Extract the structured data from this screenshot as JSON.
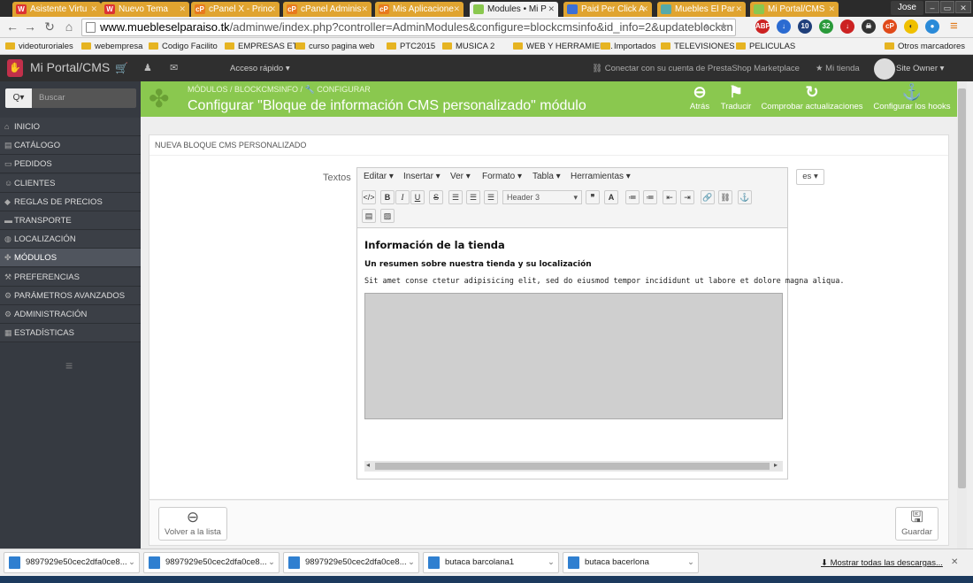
{
  "browser": {
    "tabs": [
      {
        "label": "Asistente Virtu",
        "fav": "W",
        "color": "#d33"
      },
      {
        "label": "Nuevo Tema",
        "fav": "W",
        "color": "#d33"
      },
      {
        "label": "cPanel X - Princ",
        "fav": "cP",
        "color": "#e87a1e"
      },
      {
        "label": "cPanel Adminis",
        "fav": "cP",
        "color": "#e87a1e"
      },
      {
        "label": "Mis Aplicacione",
        "fav": "cP",
        "color": "#e87a1e"
      },
      {
        "label": "Modules • Mi P",
        "fav": "",
        "color": "#8ac84f"
      },
      {
        "label": "Paid Per Click A",
        "fav": "",
        "color": "#3b6fd6"
      },
      {
        "label": "Muebles El Par",
        "fav": "",
        "color": "#5aa"
      },
      {
        "label": "Mi Portal/CMS",
        "fav": "",
        "color": "#8ac84f"
      }
    ],
    "user": "Jose",
    "url_domain": "www.muebleselparaiso.tk",
    "url_path": "/adminwe/index.php?controller=AdminModules&configure=blockcmsinfo&id_info=2&updateblockcn",
    "bookmarks": [
      "videoturoriales",
      "webempresa",
      "Codigo Facilito",
      "EMPRESAS ETT",
      "curso pagina web",
      "PTC2015",
      "MUSICA 2",
      "WEB Y HERRAMIEN...",
      "Importados",
      "TELEVISIONES",
      "PELICULAS"
    ],
    "other_bookmarks": "Otros marcadores"
  },
  "admin": {
    "site_title": "Mi Portal/CMS",
    "quick_access": "Acceso rápido",
    "marketplace": "Conectar con su cuenta de PrestaShop Marketplace",
    "my_store": "Mi tienda",
    "owner": "Site Owner",
    "search_placeholder": "Buscar",
    "search_prefix": "Q▾"
  },
  "sidebar": {
    "items": [
      {
        "label": "INICIO",
        "icon": "home-icon"
      },
      {
        "label": "CATÁLOGO",
        "icon": "book-icon"
      },
      {
        "label": "PEDIDOS",
        "icon": "credit-card-icon"
      },
      {
        "label": "CLIENTES",
        "icon": "users-icon"
      },
      {
        "label": "REGLAS DE PRECIOS",
        "icon": "tag-icon"
      },
      {
        "label": "TRANSPORTE",
        "icon": "truck-icon"
      },
      {
        "label": "LOCALIZACIÓN",
        "icon": "globe-icon"
      },
      {
        "label": "MÓDULOS",
        "icon": "puzzle-icon"
      },
      {
        "label": "PREFERENCIAS",
        "icon": "wrench-icon"
      },
      {
        "label": "PARÁMETROS AVANZADOS",
        "icon": "cogs-icon"
      },
      {
        "label": "ADMINISTRACIÓN",
        "icon": "cog-icon"
      },
      {
        "label": "ESTADÍSTICAS",
        "icon": "chart-icon"
      }
    ],
    "active_index": 7
  },
  "toolbar": {
    "breadcrumb_1": "MÓDULOS",
    "breadcrumb_2": "BLOCKCMSINFO",
    "breadcrumb_3": "CONFIGURAR",
    "title": "Configurar \"Bloque de información CMS personalizado\" módulo",
    "back": "Atrás",
    "translate": "Traducir",
    "check_updates": "Comprobar actualizaciones",
    "hooks": "Configurar los hooks"
  },
  "panel": {
    "heading": "NUEVA BLOQUE CMS PERSONALIZADO",
    "field_label": "Textos",
    "lang": "es"
  },
  "editor": {
    "menus": [
      "Editar",
      "Insertar",
      "Ver",
      "Formato",
      "Tabla",
      "Herramientas"
    ],
    "format_select": "Header 3",
    "h3": "Información de la tienda",
    "h4": "Un resumen sobre nuestra tienda y su localización",
    "paragraph": "Sit amet conse ctetur adipisicing elit, sed do eiusmod tempor incididunt ut labore et dolore magna aliqua."
  },
  "footer": {
    "back_list": "Volver a la lista",
    "save": "Guardar"
  },
  "downloads": {
    "items": [
      "9897929e50cec2dfa0ce8...",
      "9897929e50cec2dfa0ce8...",
      "9897929e50cec2dfa0ce8...",
      "butaca barcolana1",
      "butaca bacerlona"
    ],
    "show_all": "Mostrar todas las descargas..."
  }
}
